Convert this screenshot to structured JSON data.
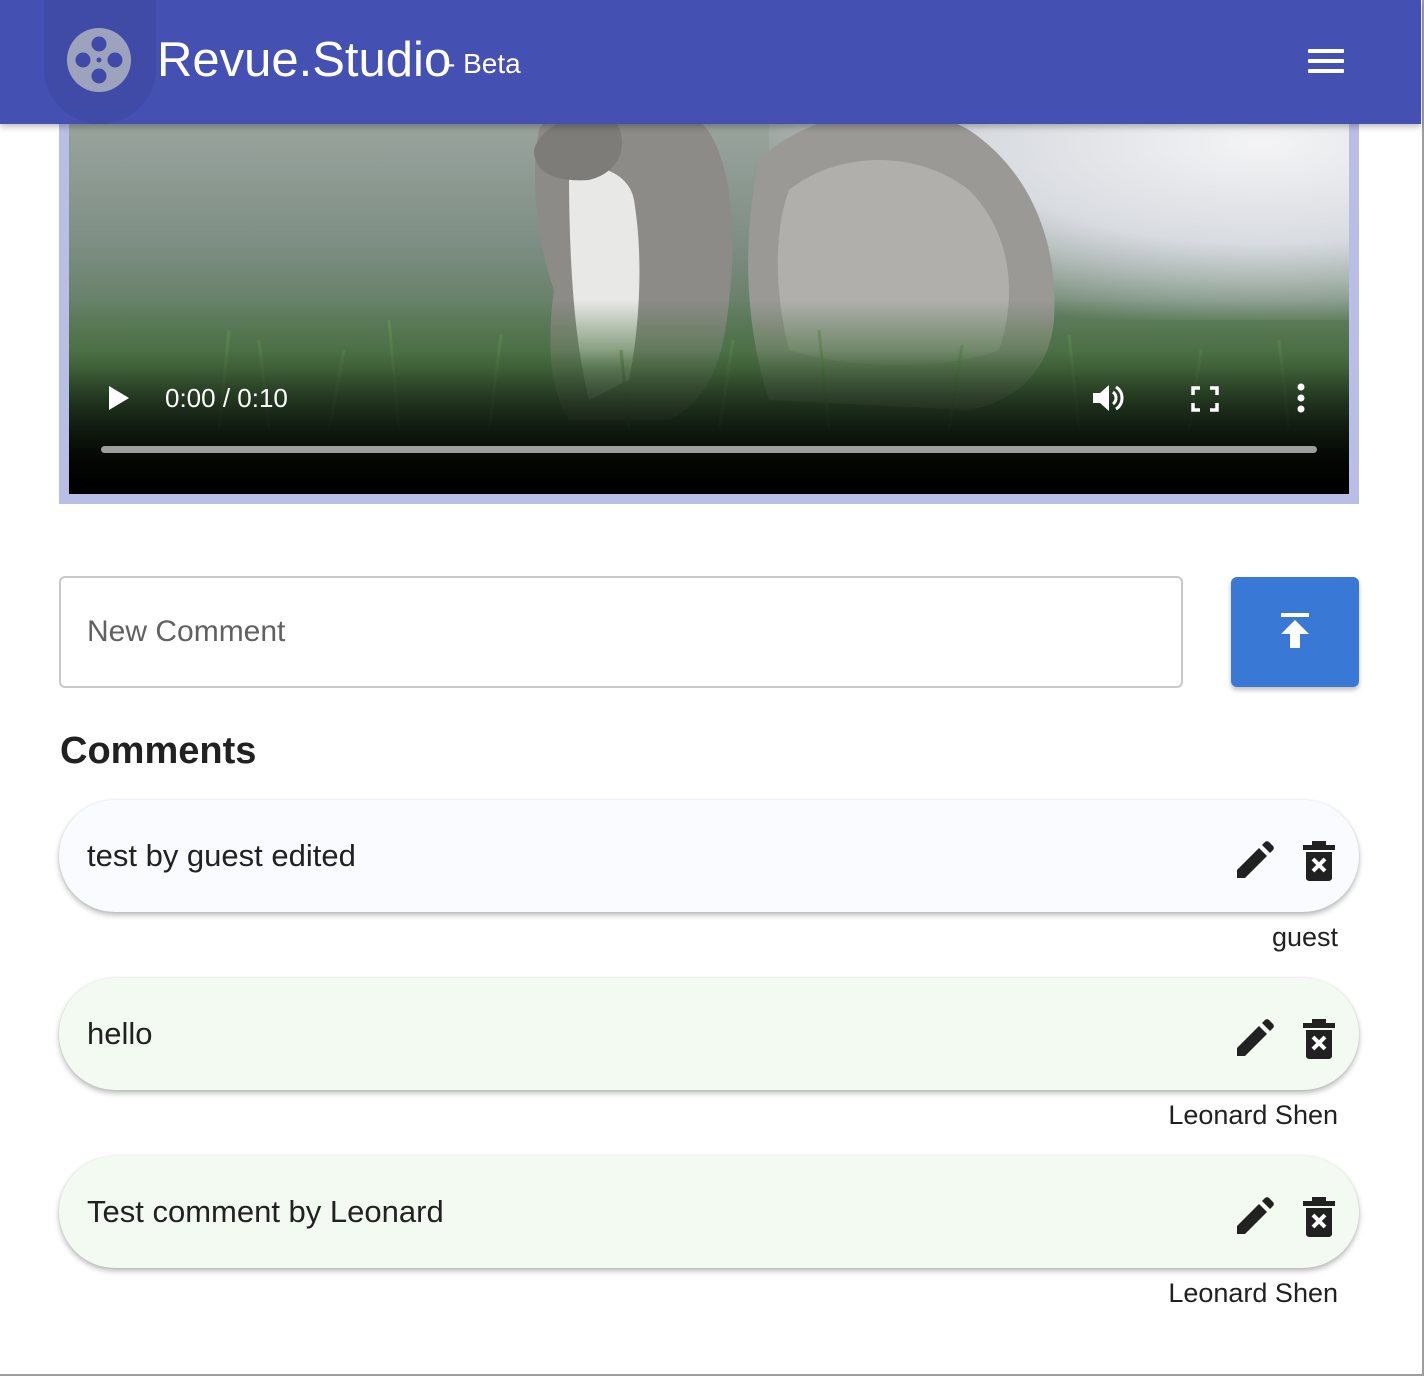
{
  "colors": {
    "brand": "#4450b2",
    "accent": "#3a78d6",
    "guest_comment_bg": "#fafbfe",
    "user_comment_bg": "#f3faf1"
  },
  "header": {
    "title": "Revue.Studio",
    "subtitle": "- Beta",
    "logo_icon": "film-reel-icon",
    "menu_icon": "hamburger-menu-icon"
  },
  "video": {
    "time": "0:00 / 0:10",
    "progress": 0.0,
    "icons": [
      "play-icon",
      "volume-icon",
      "fullscreen-icon",
      "more-vert-icon"
    ]
  },
  "new_comment": {
    "placeholder": "New Comment",
    "value": "",
    "submit_icon": "upload-arrow-icon"
  },
  "comments": {
    "heading": "Comments",
    "items": [
      {
        "text": "test by guest edited",
        "author": "guest",
        "bg": "#fafbfe"
      },
      {
        "text": "hello",
        "author": "Leonard Shen",
        "bg": "#f3faf1"
      },
      {
        "text": "Test comment by Leonard",
        "author": "Leonard Shen",
        "bg": "#f3faf1"
      }
    ],
    "edit_icon": "pencil-icon",
    "delete_icon": "trash-x-icon"
  }
}
